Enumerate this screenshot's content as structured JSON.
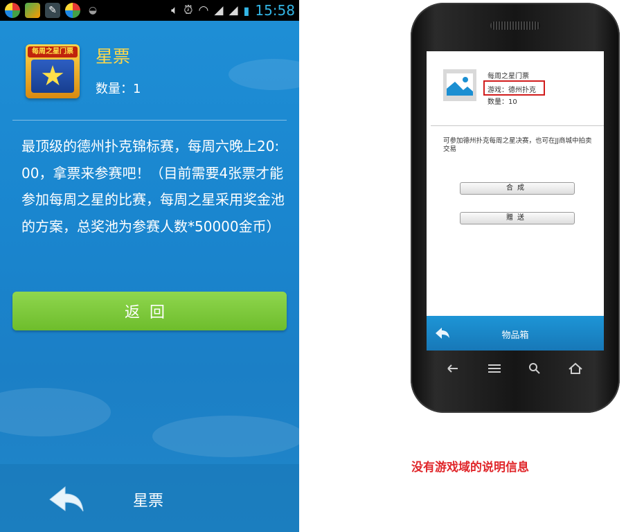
{
  "status_bar": {
    "time": "15:58",
    "left_icons": [
      "app-icon-1",
      "app-icon-2",
      "app-icon-3",
      "app-icon-4",
      "android-icon"
    ],
    "right_icons": [
      "volume-icon",
      "alarm-icon",
      "wifi-icon",
      "signal-icon",
      "signal-icon",
      "battery-charging-icon"
    ]
  },
  "item_detail": {
    "thumb_banner": "每周之星门票",
    "title": "星票",
    "quantity_label": "数量：",
    "quantity_value": "1",
    "description": "最顶级的德州扑克锦标赛，每周六晚上20:00，拿票来参赛吧！（目前需要4张票才能参加每周之星的比赛，每周之星采用奖金池的方案，总奖池为参赛人数*50000金币）",
    "back_button_label": "返回",
    "bottom_bar_title": "星票"
  },
  "mockup": {
    "item_name": "每周之星门票",
    "game_label": "游戏：德州扑克",
    "quantity_label": "数量：10",
    "description": "可参加德州扑克每周之星决赛，也可在JJ商城中拍卖交易",
    "compose_button": "合成",
    "gift_button": "赠送",
    "bottom_bar_title": "物品箱",
    "nav_keys": [
      "back-key-icon",
      "menu-key-icon",
      "search-key-icon",
      "home-key-icon"
    ]
  },
  "annotation": {
    "note": "没有游戏域的说明信息",
    "color": "#e0262a"
  },
  "colors": {
    "title_yellow": "#ffd84a",
    "button_green": "#7cc83a",
    "screen_blue": "#1f8fd6",
    "status_blue": "#33b5e5"
  }
}
